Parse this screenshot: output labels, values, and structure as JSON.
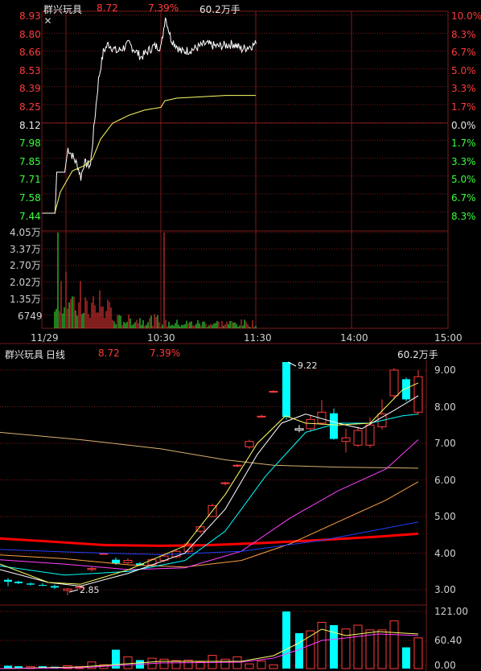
{
  "colors": {
    "up": "#ff3b3b",
    "down": "#3bff3b",
    "cyan": "#00ffff",
    "grid": "#7a1a1a",
    "price_line": "#ffffff",
    "avg_line": "#ffff66",
    "ma_red": "#ff0000",
    "ma_orange": "#ffa040",
    "ma_magenta": "#ff40ff",
    "ma_blue": "#2040ff",
    "ma_tan": "#d8b070"
  },
  "intraday": {
    "stock_name": "群兴玩具",
    "price": "8.72",
    "pct": "7.39%",
    "volume": "60.2万手",
    "close_icon": "close-icon",
    "left_prices": [
      "8.93",
      "8.80",
      "8.66",
      "8.53",
      "8.39",
      "8.25",
      "8.12",
      "7.98",
      "7.85",
      "7.71",
      "7.58",
      "7.44"
    ],
    "right_pcts": [
      "10.0%",
      "8.3%",
      "6.7%",
      "5.0%",
      "3.3%",
      "1.7%",
      "0.0%",
      "1.7%",
      "3.3%",
      "5.0%",
      "6.7%",
      "8.3%"
    ],
    "vol_labels": [
      "4.05万",
      "3.37万",
      "2.70万",
      "2.02万",
      "1.35万",
      "6749"
    ],
    "time_labels": [
      "11/29",
      "10:30",
      "11:30",
      "14:00",
      "15:00"
    ]
  },
  "daily": {
    "stock_name": "群兴玩具",
    "period": "日线",
    "price": "8.72",
    "pct": "7.39%",
    "volume": "60.2万手",
    "price_axis": [
      "9.00",
      "8.00",
      "7.00",
      "6.00",
      "5.00",
      "4.00",
      "3.00"
    ],
    "vol_axis": [
      "121.00",
      "60.40",
      "0.00"
    ],
    "high_annotation": "9.22",
    "low_annotation": "2.85"
  },
  "chart_data": [
    {
      "type": "line",
      "series": [
        {
          "values": [
            7.44,
            7.75,
            7.75,
            7.93,
            7.9,
            7.78,
            7.7,
            7.8,
            8.2,
            8.5,
            8.65,
            8.6,
            8.7,
            8.68,
            8.62,
            8.65,
            8.93,
            8.72,
            8.66,
            8.68,
            8.7,
            8.68,
            8.72,
            8.7,
            8.72
          ]
        },
        {
          "values": [
            7.44,
            7.6,
            7.7,
            7.76,
            7.78,
            7.8,
            7.82,
            7.9,
            8.0,
            8.1,
            8.15,
            8.18,
            8.2,
            8.22,
            8.24,
            8.25,
            8.26,
            8.27,
            8.29,
            8.3,
            8.31,
            8.32,
            8.32,
            8.32,
            8.33
          ]
        }
      ],
      "ylim": [
        7.44,
        8.93
      ]
    },
    {
      "type": "bar",
      "values": [
        40500,
        14000,
        24000,
        8000,
        20000,
        12000,
        6000,
        3000,
        2000,
        1500,
        1200,
        1000,
        800,
        700,
        600,
        40500,
        5000,
        2000,
        1500,
        1200,
        1000,
        900,
        800,
        700,
        600
      ],
      "ylim": [
        0,
        40500
      ]
    },
    {
      "type": "bar",
      "series": [
        {
          "values": [
            3.2,
            3.15,
            3.1,
            3.0,
            2.95,
            3.0,
            3.05,
            3.1,
            3.6,
            3.7,
            3.75,
            3.7,
            3.8,
            3.85,
            4.0,
            4.1,
            4.4,
            4.8,
            5.2,
            5.8,
            6.3,
            6.8,
            7.6,
            8.4,
            9.2,
            7.4,
            7.6,
            7.8,
            7.5,
            7.2,
            7.4,
            7.6,
            7.7,
            8.2,
            8.6,
            8.7
          ]
        }
      ],
      "ylim": [
        2.7,
        9.3
      ]
    }
  ]
}
